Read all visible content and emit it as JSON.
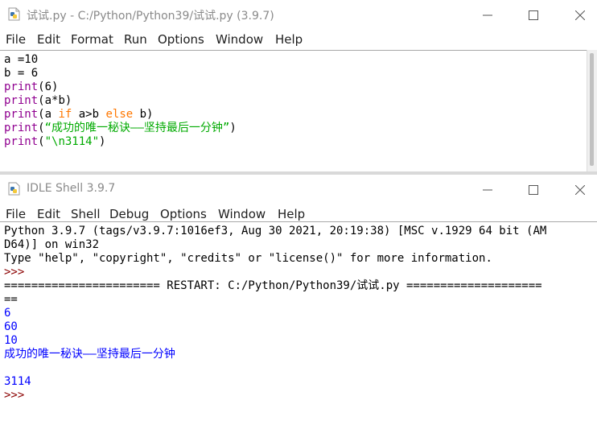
{
  "colors": {
    "builtin": "#900090",
    "keyword": "#ff7700",
    "string": "#00aa00",
    "stdout": "#0000ff",
    "restart": "#000000"
  },
  "editor": {
    "title": "试试.py - C:/Python/Python39/试试.py (3.9.7)",
    "icon": "python-file-icon",
    "menu": [
      "File",
      "Edit",
      "Format",
      "Run",
      "Options",
      "Window",
      "Help"
    ],
    "code": [
      "a =10",
      "b = 6",
      "print(6)",
      "print(a*b)",
      "print(a if a>b else b)",
      "print(“成功的唯一秘诀——坚持最后一分钟”)",
      "print(\"\\n3114\")"
    ]
  },
  "shell": {
    "title": "IDLE Shell 3.9.7",
    "icon": "python-icon",
    "menu": [
      "File",
      "Edit",
      "Shell",
      "Debug",
      "Options",
      "Window",
      "Help"
    ],
    "lines": [
      "Python 3.9.7 (tags/v3.9.7:1016ef3, Aug 30 2021, 20:19:38) [MSC v.1929 64 bit (AM",
      "D64)] on win32",
      "Type \"help\", \"copyright\", \"credits\" or \"license()\" for more information.",
      ">>>",
      "======================= RESTART: C:/Python/Python39/试试.py ====================",
      "==",
      "6",
      "60",
      "10",
      "成功的唯一秘诀——坚持最后一分钟",
      "",
      "3114",
      ">>>"
    ]
  }
}
